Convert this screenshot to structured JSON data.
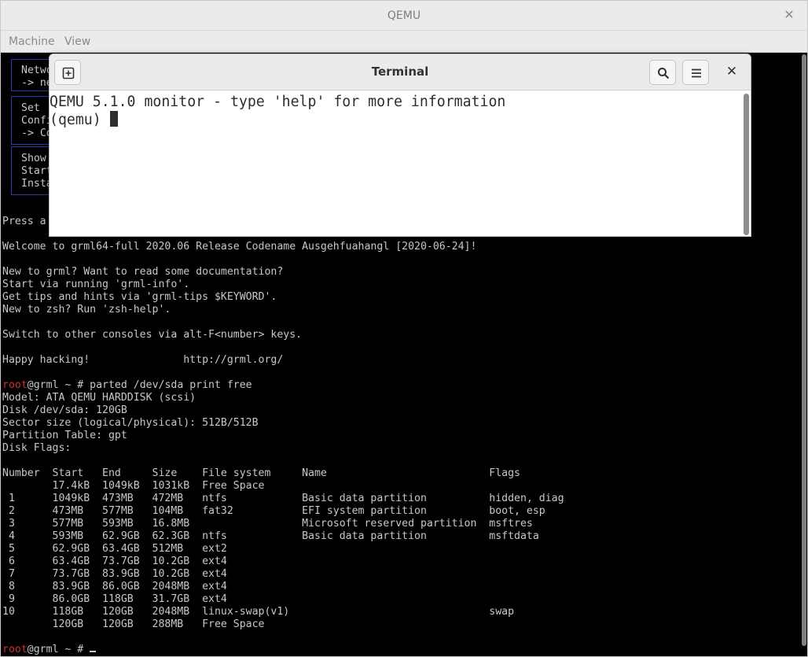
{
  "qemu": {
    "title": "QEMU",
    "menu": [
      "Machine",
      "View"
    ]
  },
  "boot_menu_fragments": [
    {
      "lines": [
        "Netwo",
        "-> ne"
      ]
    },
    {
      "lines": [
        "Set ",
        "Confi",
        "-> Co"
      ]
    },
    {
      "lines": [
        "Show ",
        "Start",
        "Insta"
      ]
    }
  ],
  "console": {
    "press_line": "Press a",
    "welcome": "Welcome to grml64-full 2020.06 Release Codename Ausgehfuahangl [2020-06-24]!",
    "docs": [
      "New to grml? Want to read some documentation?",
      "Start via running 'grml-info'.",
      "Get tips and hints via 'grml-tips $KEYWORD'.",
      "New to zsh? Run 'zsh-help'."
    ],
    "switch": "Switch to other consoles via alt-F<number> keys.",
    "happy": "Happy hacking!               http://grml.org/",
    "prompt_user": "root",
    "prompt_rest": "@grml ~ # ",
    "command": "parted /dev/sda print free",
    "disk_info": [
      "Model: ATA QEMU HARDDISK (scsi)",
      "Disk /dev/sda: 120GB",
      "Sector size (logical/physical): 512B/512B",
      "Partition Table: gpt",
      "Disk Flags:"
    ],
    "table_header": "Number  Start   End     Size    File system     Name                          Flags",
    "table_rows": [
      "        17.4kB  1049kB  1031kB  Free Space",
      " 1      1049kB  473MB   472MB   ntfs            Basic data partition          hidden, diag",
      " 2      473MB   577MB   104MB   fat32           EFI system partition          boot, esp",
      " 3      577MB   593MB   16.8MB                  Microsoft reserved partition  msftres",
      " 4      593MB   62.9GB  62.3GB  ntfs            Basic data partition          msftdata",
      " 5      62.9GB  63.4GB  512MB   ext2",
      " 6      63.4GB  73.7GB  10.2GB  ext4",
      " 7      73.7GB  83.9GB  10.2GB  ext4",
      " 8      83.9GB  86.0GB  2048MB  ext4",
      " 9      86.0GB  118GB   31.7GB  ext4",
      "10      118GB   120GB   2048MB  linux-swap(v1)                                swap",
      "        120GB   120GB   288MB   Free Space"
    ]
  },
  "terminal": {
    "title": "Terminal",
    "line1": "QEMU 5.1.0 monitor - type 'help' for more information",
    "prompt": "(qemu) ",
    "icons": {
      "new_tab": "new-tab-icon",
      "search": "search-icon",
      "menu": "hamburger-menu-icon",
      "close": "close-icon"
    }
  },
  "colors": {
    "root_prompt": "#d03030",
    "console_text": "#c8c8c8",
    "menu_border": "#2b3aa0"
  }
}
